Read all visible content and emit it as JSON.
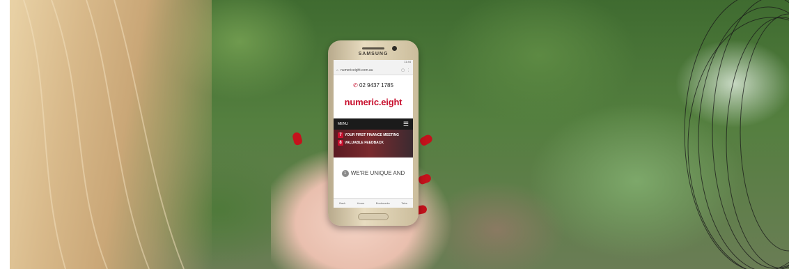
{
  "scene": {
    "description_tags": [
      "hand-holding-phone",
      "blurred-foliage-background"
    ]
  },
  "phone": {
    "brand": "SAMSUNG",
    "screen": {
      "status_time": "11:44",
      "url": "numericeight.com.au",
      "phone_number": "02 9437 1785",
      "logo": "numeric.eight",
      "menu_label": "MENU",
      "banner": {
        "line1_num": "7",
        "line1_text": "YOUR FIRST FINANCE MEETING",
        "line2_num": "8",
        "line2_text": "VALUABLE FEEDBACK"
      },
      "hero_num": "1",
      "hero_text": "WE'RE UNIQUE AND",
      "nav": [
        "Back",
        "Home",
        "Bookmarks",
        "Tabs"
      ]
    }
  },
  "colors": {
    "brand_red": "#c8102e",
    "nail_red": "#c4121c"
  }
}
